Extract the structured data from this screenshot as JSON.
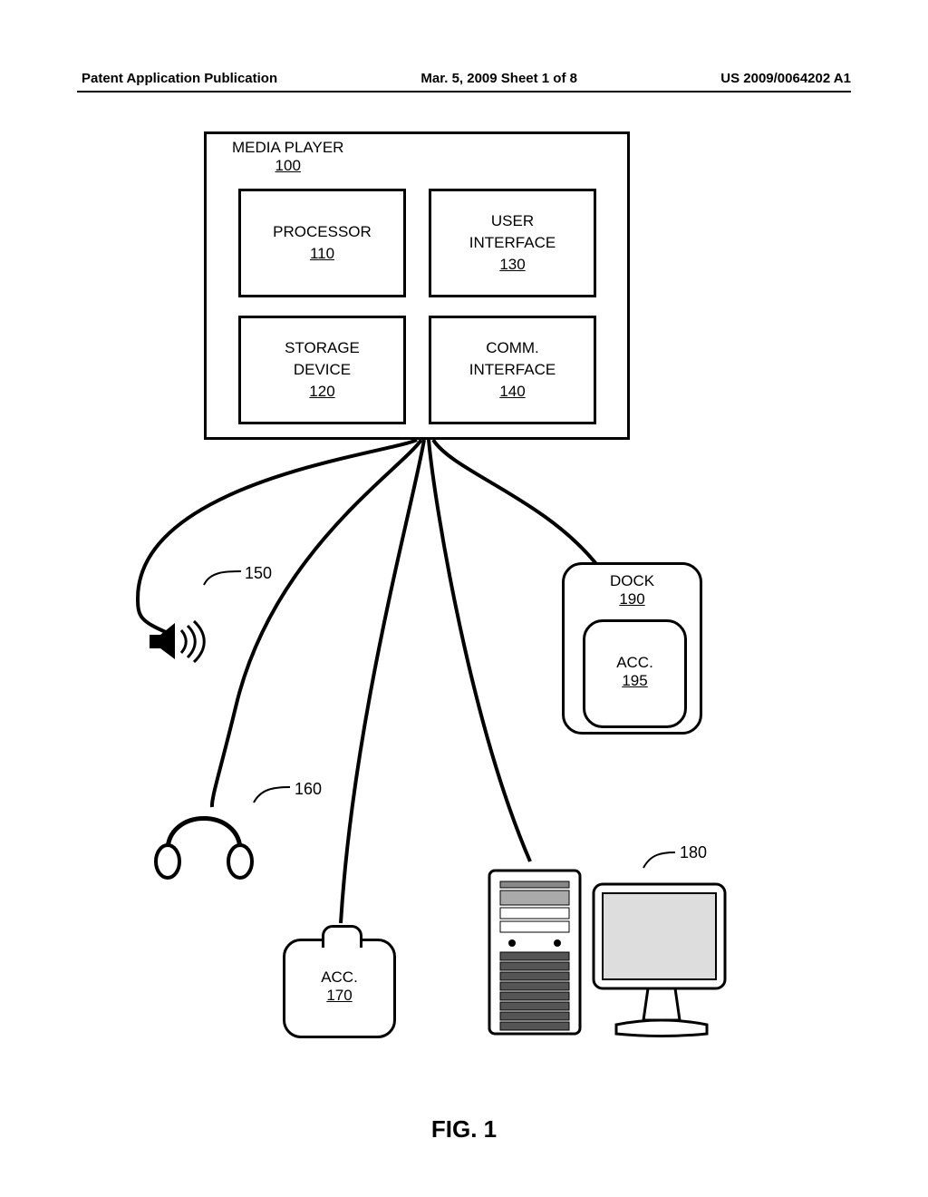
{
  "header": {
    "left": "Patent Application Publication",
    "center": "Mar. 5, 2009  Sheet 1 of 8",
    "right": "US 2009/0064202 A1"
  },
  "media_player": {
    "title": "MEDIA PLAYER",
    "number": "100",
    "processor": {
      "label": "PROCESSOR",
      "number": "110"
    },
    "storage": {
      "label": "STORAGE\nDEVICE",
      "number": "120"
    },
    "ui": {
      "label": "USER\nINTERFACE",
      "number": "130"
    },
    "comm": {
      "label": "COMM.\nINTERFACE",
      "number": "140"
    }
  },
  "refs": {
    "speaker": "150",
    "headphones": "160",
    "acc": {
      "label": "ACC.",
      "number": "170"
    },
    "computer": "180",
    "dock": {
      "label": "DOCK",
      "number": "190"
    },
    "dock_acc": {
      "label": "ACC.",
      "number": "195"
    }
  },
  "figure_label": "FIG. 1"
}
